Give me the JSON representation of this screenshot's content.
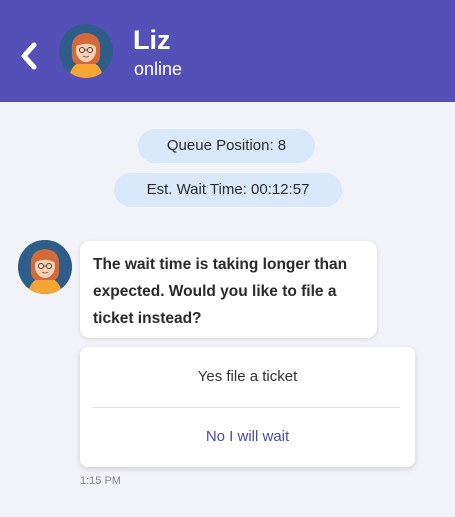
{
  "header": {
    "back_icon": "chevron-left-icon",
    "avatar_icon": "agent-avatar",
    "name": "Liz",
    "status": "online",
    "background_color": "#5550b7"
  },
  "queue": {
    "position_text": "Queue Position: 8",
    "wait_text": "Est. Wait Time: 00:12:57"
  },
  "message": {
    "avatar_icon": "agent-avatar",
    "text": "The wait time is taking longer than expected. Would you like to file a ticket instead?",
    "timestamp": "1:15 PM"
  },
  "options": [
    {
      "label": "Yes file a ticket"
    },
    {
      "label": "No I will wait"
    }
  ],
  "colors": {
    "accent": "#4b4bae",
    "pill_bg": "#d9e8fb",
    "page_bg": "#f2f3f8"
  }
}
